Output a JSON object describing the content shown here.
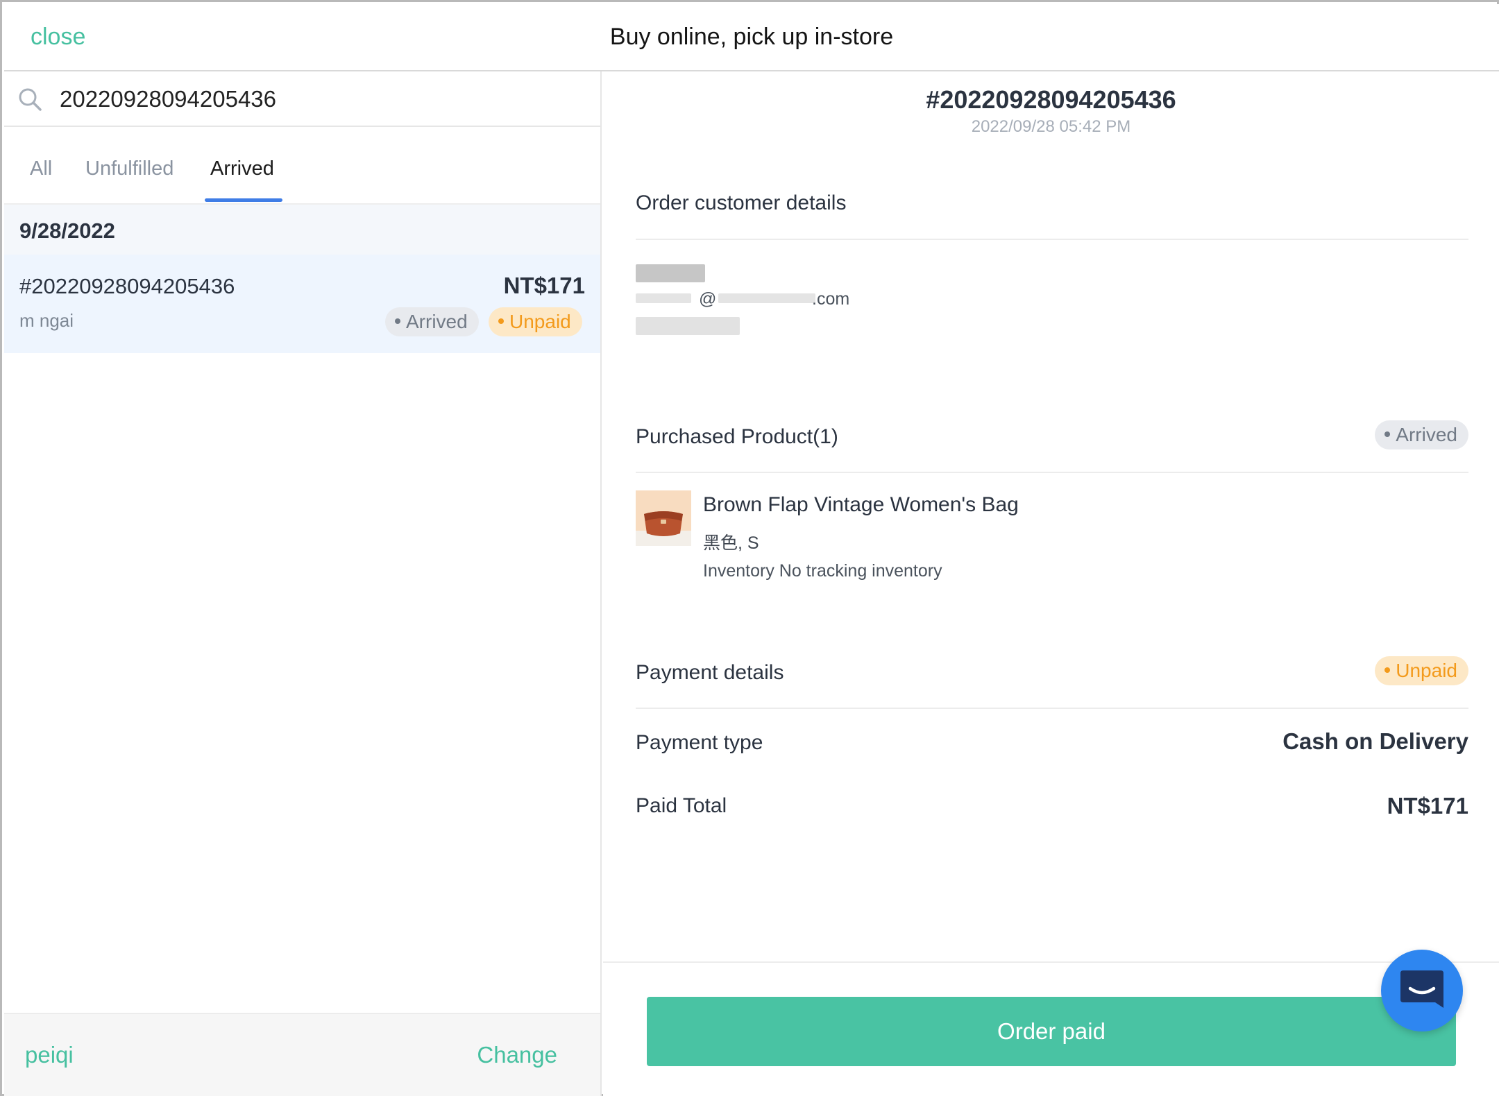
{
  "header": {
    "close_label": "close",
    "title": "Buy online, pick up in-store"
  },
  "search": {
    "value": "20220928094205436",
    "icon": "search-icon"
  },
  "tabs": [
    {
      "label": "All",
      "active": false
    },
    {
      "label": "Unfulfilled",
      "active": false
    },
    {
      "label": "Arrived",
      "active": true
    }
  ],
  "order_list": {
    "group_date": "9/28/2022",
    "orders": [
      {
        "id": "#20220928094205436",
        "amount": "NT$171",
        "customer": "m ngai",
        "status_badge": "Arrived",
        "payment_badge": "Unpaid"
      }
    ]
  },
  "footer": {
    "staff": "peiqi",
    "change_label": "Change"
  },
  "detail": {
    "order_id": "#20220928094205436",
    "order_datetime": "2022/09/28 05:42 PM",
    "customer_section_title": "Order customer details",
    "customer_email_fragments": [
      "@",
      ".com"
    ],
    "product_section_title": "Purchased Product(1)",
    "product_status_badge": "Arrived",
    "product": {
      "name": "Brown Flap Vintage Women's Bag",
      "variant": "黑色, S",
      "inventory": "Inventory No tracking inventory"
    },
    "payment_section_title": "Payment details",
    "payment_status_badge": "Unpaid",
    "payment_type_label": "Payment type",
    "payment_type_value": "Cash on Delivery",
    "paid_total_label": "Paid Total",
    "paid_total_value": "NT$171",
    "action_button_label": "Order paid"
  },
  "colors": {
    "accent": "#46c0a0",
    "tab_underline": "#3f7de6",
    "unpaid": "#f39a1b",
    "arrived": "#717a86",
    "chat_button": "#2e86f0"
  },
  "chat_fab_icon": "chat-icon"
}
